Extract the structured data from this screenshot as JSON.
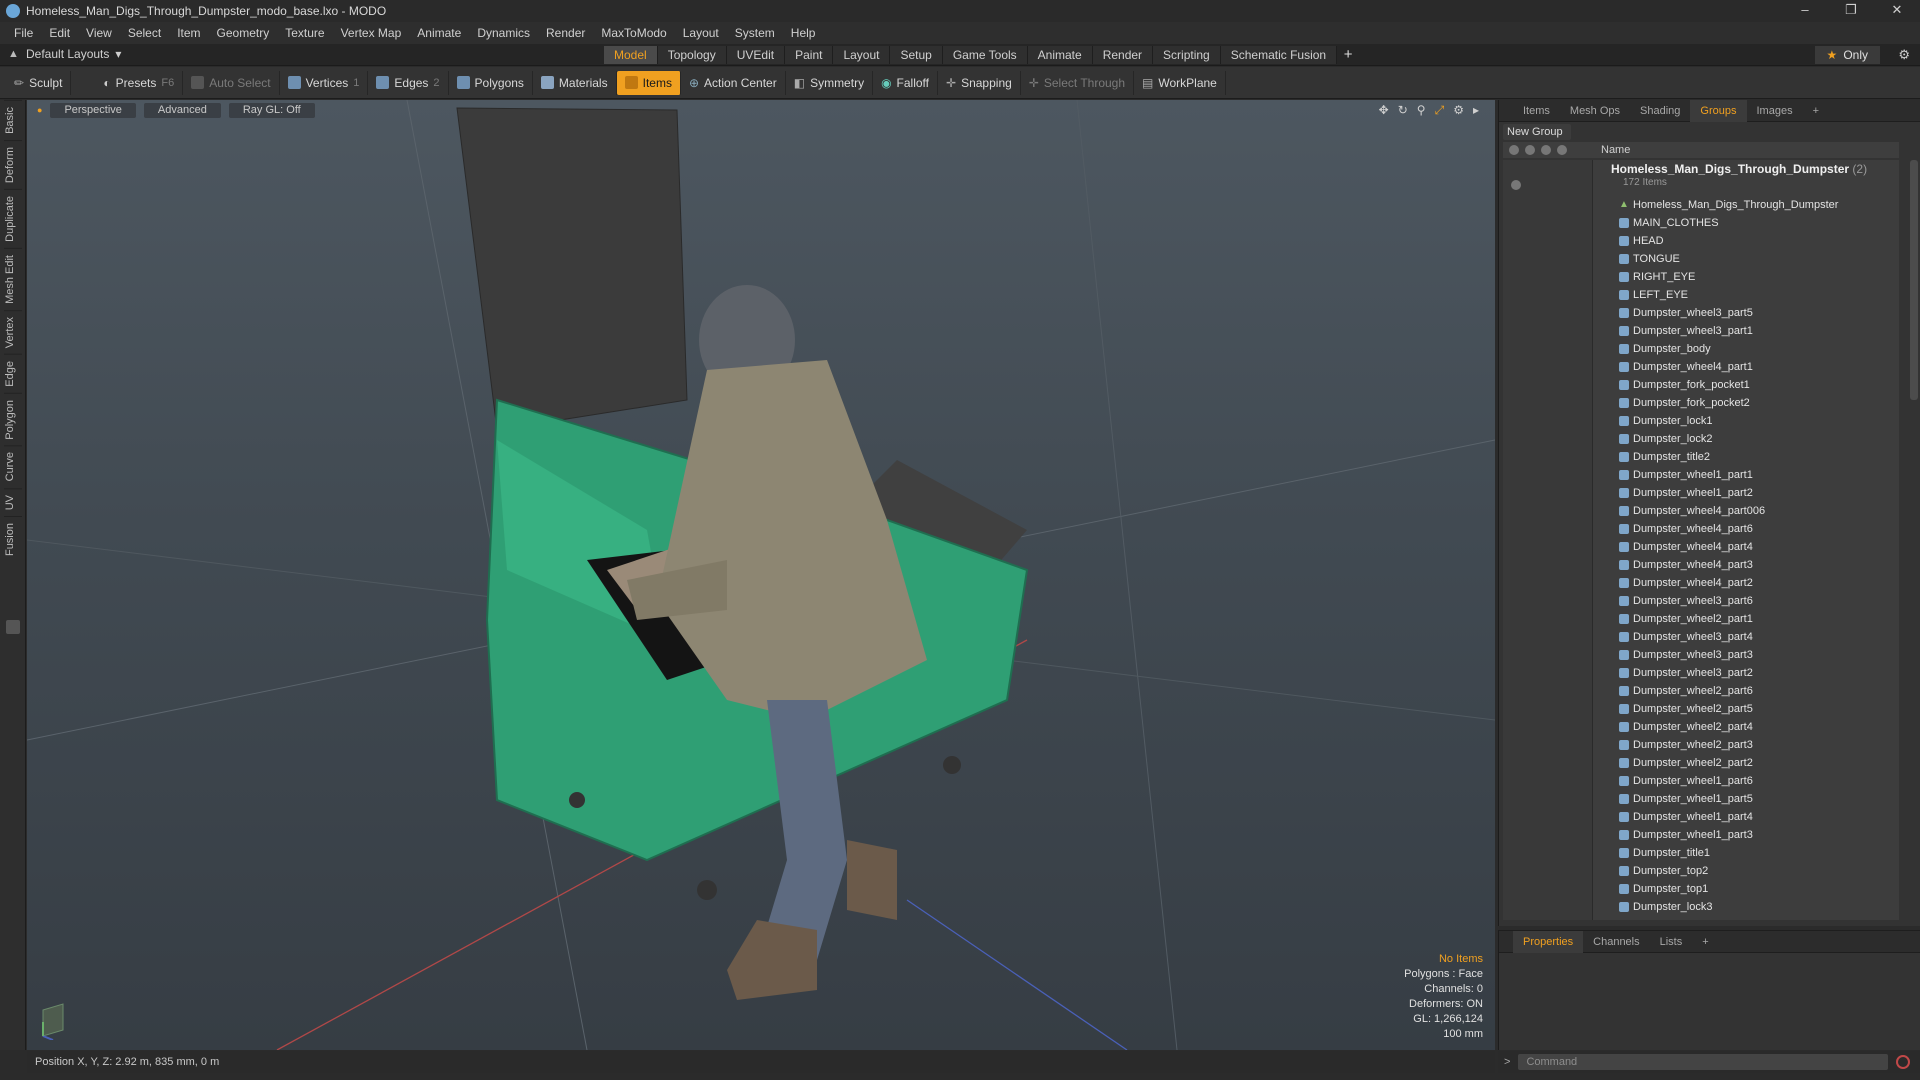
{
  "window": {
    "title": "Homeless_Man_Digs_Through_Dumpster_modo_base.lxo - MODO"
  },
  "menu": [
    "File",
    "Edit",
    "View",
    "Select",
    "Item",
    "Geometry",
    "Texture",
    "Vertex Map",
    "Animate",
    "Dynamics",
    "Render",
    "MaxToModo",
    "Layout",
    "System",
    "Help"
  ],
  "layouts": {
    "label": "Default Layouts"
  },
  "mode_tabs": [
    {
      "label": "Model",
      "active": true
    },
    {
      "label": "Topology"
    },
    {
      "label": "UVEdit"
    },
    {
      "label": "Paint"
    },
    {
      "label": "Layout"
    },
    {
      "label": "Setup"
    },
    {
      "label": "Game Tools"
    },
    {
      "label": "Animate"
    },
    {
      "label": "Render"
    },
    {
      "label": "Scripting"
    },
    {
      "label": "Schematic Fusion"
    }
  ],
  "only_label": "Only",
  "toolbar": {
    "sculpt": "Sculpt",
    "presets": "Presets",
    "presets_key": "F6",
    "auto_select": "Auto Select",
    "vertices": "Vertices",
    "vertices_count": "1",
    "edges": "Edges",
    "edges_count": "2",
    "polygons": "Polygons",
    "materials": "Materials",
    "items": "Items",
    "action_center": "Action Center",
    "symmetry": "Symmetry",
    "falloff": "Falloff",
    "snapping": "Snapping",
    "select_through": "Select Through",
    "workplane": "WorkPlane"
  },
  "left_tabs": [
    "Basic",
    "Deform",
    "Duplicate",
    "Mesh Edit",
    "Vertex",
    "Edge",
    "Polygon",
    "Curve",
    "UV",
    "Fusion"
  ],
  "viewport": {
    "view": "Perspective",
    "shading": "Advanced",
    "raygl": "Ray GL: Off",
    "stats": {
      "selection": "No Items",
      "polygons": "Polygons : Face",
      "channels": "Channels: 0",
      "deformers": "Deformers: ON",
      "gl": "GL: 1,266,124",
      "scale": "100 mm"
    }
  },
  "status": {
    "position": "Position X, Y, Z:  2.92 m, 835 mm, 0 m"
  },
  "right_panel": {
    "tabs": [
      {
        "label": "Items"
      },
      {
        "label": "Mesh Ops"
      },
      {
        "label": "Shading"
      },
      {
        "label": "Groups",
        "active": true
      },
      {
        "label": "Images"
      }
    ],
    "new_group": "New Group",
    "column_name": "Name",
    "root": {
      "name": "Homeless_Man_Digs_Through_Dumpster",
      "count": "(2)",
      "sub": "172 Items"
    },
    "items": [
      "Homeless_Man_Digs_Through_Dumpster",
      "MAIN_CLOTHES",
      "HEAD",
      "TONGUE",
      "RIGHT_EYE",
      "LEFT_EYE",
      "Dumpster_wheel3_part5",
      "Dumpster_wheel3_part1",
      "Dumpster_body",
      "Dumpster_wheel4_part1",
      "Dumpster_fork_pocket1",
      "Dumpster_fork_pocket2",
      "Dumpster_lock1",
      "Dumpster_lock2",
      "Dumpster_title2",
      "Dumpster_wheel1_part1",
      "Dumpster_wheel1_part2",
      "Dumpster_wheel4_part006",
      "Dumpster_wheel4_part6",
      "Dumpster_wheel4_part4",
      "Dumpster_wheel4_part3",
      "Dumpster_wheel4_part2",
      "Dumpster_wheel3_part6",
      "Dumpster_wheel2_part1",
      "Dumpster_wheel3_part4",
      "Dumpster_wheel3_part3",
      "Dumpster_wheel3_part2",
      "Dumpster_wheel2_part6",
      "Dumpster_wheel2_part5",
      "Dumpster_wheel2_part4",
      "Dumpster_wheel2_part3",
      "Dumpster_wheel2_part2",
      "Dumpster_wheel1_part6",
      "Dumpster_wheel1_part5",
      "Dumpster_wheel1_part4",
      "Dumpster_wheel1_part3",
      "Dumpster_title1",
      "Dumpster_top2",
      "Dumpster_top1",
      "Dumpster_lock3"
    ],
    "bottom_tabs": [
      {
        "label": "Properties",
        "active": true
      },
      {
        "label": "Channels"
      },
      {
        "label": "Lists"
      }
    ]
  },
  "command": {
    "placeholder": "Command"
  },
  "colors": {
    "accent": "#f0a020",
    "dumpster": "#2fa57a",
    "lid": "#3a3a3a"
  }
}
